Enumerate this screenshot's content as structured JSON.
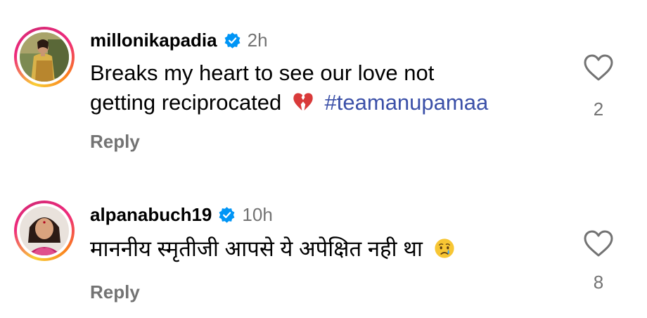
{
  "comments": [
    {
      "username": "millonikapadia",
      "verified": true,
      "time": "2h",
      "text_line1": "Breaks my heart to see our love not",
      "text_line2": "getting reciprocated",
      "emoji": "broken-heart-icon",
      "hashtag": "#teamanupamaa",
      "reply_label": "Reply",
      "like_count": "2"
    },
    {
      "username": "alpanabuch19",
      "verified": true,
      "time": "10h",
      "text": "माननीय स्मृतीजी आपसे ये अपेक्षित नही था",
      "emoji": "crying-face-icon",
      "reply_label": "Reply",
      "like_count": "8"
    }
  ],
  "colors": {
    "verified_blue": "#0095f6",
    "hashtag": "#3b50a8",
    "muted_text": "#737373",
    "text": "#000000"
  }
}
